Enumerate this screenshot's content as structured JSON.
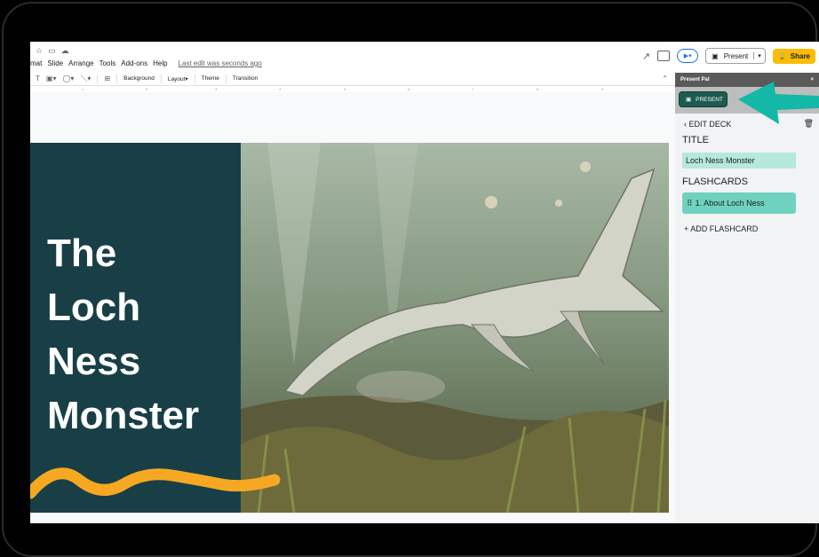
{
  "menu": {
    "items": [
      "mat",
      "Slide",
      "Arrange",
      "Tools",
      "Add-ons",
      "Help"
    ],
    "last_edit": "Last edit was seconds ago"
  },
  "header": {
    "present": "Present",
    "share": "Share"
  },
  "toolbar": {
    "background": "Background",
    "layout": "Layout",
    "theme": "Theme",
    "transition": "Transition"
  },
  "ruler": [
    "1",
    "2",
    "3",
    "4",
    "5",
    "6",
    "7",
    "8",
    "9"
  ],
  "slide": {
    "title_lines": [
      "The",
      "Loch",
      "Ness",
      "Monster"
    ]
  },
  "panel": {
    "title": "Present Pal",
    "close": "×",
    "present_label": "PRESENT",
    "edit_deck": "EDIT DECK",
    "title_label": "TITLE",
    "title_value": "Loch Ness Monster",
    "flashcards_label": "FLASHCARDS",
    "flashcards": [
      "1. About Loch Ness"
    ],
    "add_flashcard": "+ ADD FLASHCARD"
  },
  "colors": {
    "slide_panel": "#183f46",
    "accent_yellow": "#fbbc04",
    "squiggle": "#f7a823",
    "teal_arrow": "#14b8a6",
    "flashcard": "#6fd2bf"
  }
}
